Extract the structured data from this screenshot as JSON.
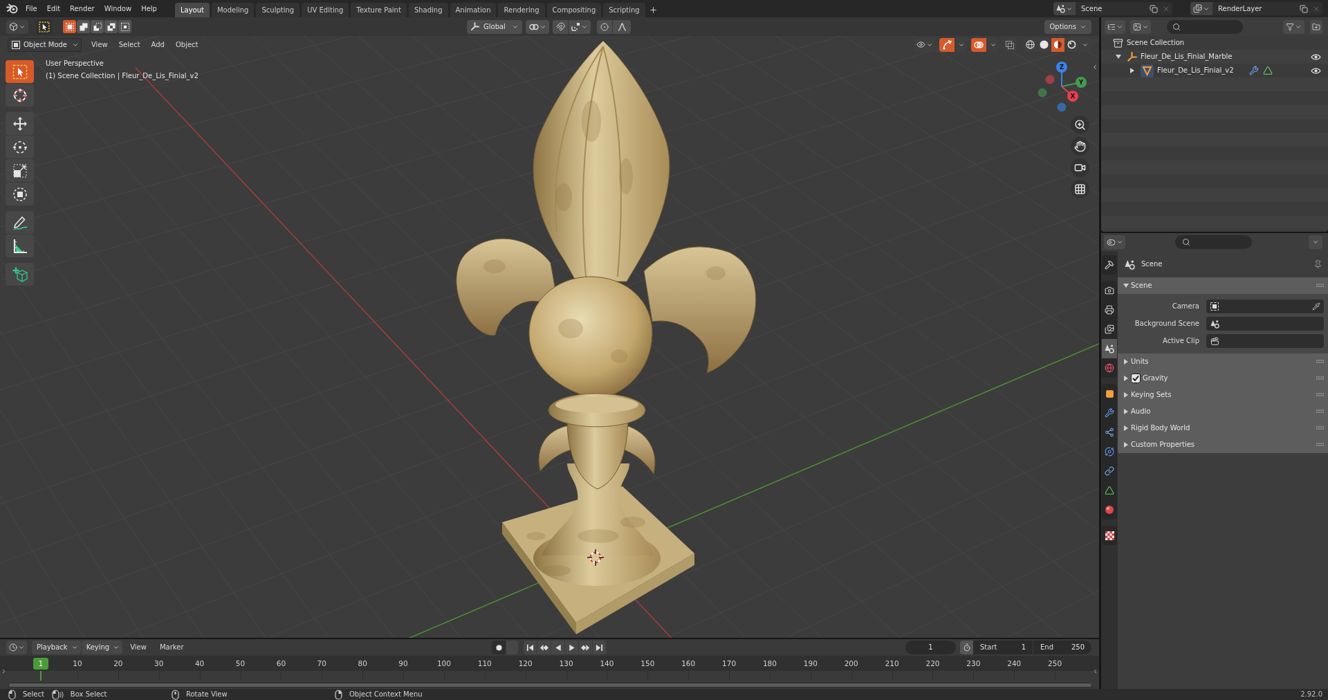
{
  "top_bar": {
    "menus": [
      "File",
      "Edit",
      "Render",
      "Window",
      "Help"
    ],
    "workspaces": [
      {
        "label": "Layout",
        "selected": true
      },
      {
        "label": "Modeling",
        "selected": false
      },
      {
        "label": "Sculpting",
        "selected": false
      },
      {
        "label": "UV Editing",
        "selected": false
      },
      {
        "label": "Texture Paint",
        "selected": false
      },
      {
        "label": "Shading",
        "selected": false
      },
      {
        "label": "Animation",
        "selected": false
      },
      {
        "label": "Rendering",
        "selected": false
      },
      {
        "label": "Compositing",
        "selected": false
      },
      {
        "label": "Scripting",
        "selected": false
      }
    ],
    "scene": "Scene",
    "view_layer": "RenderLayer"
  },
  "tool_header": {
    "selection_modes": [
      {
        "kind": "set",
        "selected": true
      },
      {
        "kind": "extend",
        "selected": false
      },
      {
        "kind": "subtract",
        "selected": false
      },
      {
        "kind": "difference",
        "selected": false
      },
      {
        "kind": "intersect",
        "selected": false
      }
    ],
    "transform_orientation": "Global",
    "snap": {
      "on": false
    },
    "proportional_editing": {
      "on": false
    },
    "options": "Options"
  },
  "viewport_header": {
    "mode": "Object Mode",
    "menus": [
      "View",
      "Select",
      "Add",
      "Object"
    ],
    "toggles": [
      {
        "kind": "gizmo",
        "on": true
      },
      {
        "kind": "overlay",
        "on": true
      },
      {
        "kind": "xray",
        "on": false
      }
    ],
    "shading_modes": [
      {
        "kind": "wireframe",
        "selected": false
      },
      {
        "kind": "solid",
        "selected": false
      },
      {
        "kind": "material",
        "selected": true
      },
      {
        "kind": "rendered",
        "selected": false
      }
    ]
  },
  "viewport": {
    "view_name": "User Perspective",
    "context": "(1) Scene Collection | Fleur_De_Lis_Finial_v2",
    "tool_groups": [
      {
        "tools": [
          {
            "kind": "select_box",
            "selected": true
          },
          {
            "kind": "cursor",
            "selected": false
          }
        ]
      },
      {
        "tools": [
          {
            "kind": "move",
            "selected": false
          },
          {
            "kind": "rotate",
            "selected": false
          },
          {
            "kind": "scale",
            "selected": false
          },
          {
            "kind": "transform",
            "selected": false
          }
        ]
      },
      {
        "tools": [
          {
            "kind": "annotate",
            "selected": false
          },
          {
            "kind": "measure",
            "selected": false
          }
        ]
      },
      {
        "tools": [
          {
            "kind": "add_cube",
            "selected": false
          }
        ]
      }
    ],
    "nav_axes": [
      {
        "label": "Z",
        "color": "#3b83e6"
      },
      {
        "label": "Y",
        "color": "#46994f"
      },
      {
        "label": "X",
        "color": "#e5404f"
      }
    ]
  },
  "outliner": {
    "tree": [
      {
        "name": "Scene Collection",
        "kind": "collection",
        "children": [
          {
            "name": "Fleur_De_Lis_Finial_Marble",
            "kind": "empty",
            "expanded": true,
            "visible": true,
            "children": [
              {
                "name": "Fleur_De_Lis_Finial_v2",
                "kind": "mesh",
                "expanded": false,
                "visible": true
              }
            ]
          }
        ]
      }
    ]
  },
  "properties": {
    "tab_groups": [
      {
        "tabs": [
          {
            "kind": "tool",
            "selected": false
          }
        ]
      },
      {
        "tabs": [
          {
            "kind": "render",
            "selected": false
          },
          {
            "kind": "output",
            "selected": false
          },
          {
            "kind": "view_layer",
            "selected": false
          },
          {
            "kind": "scene",
            "selected": true
          },
          {
            "kind": "world",
            "selected": false
          }
        ]
      },
      {
        "tabs": [
          {
            "kind": "object",
            "selected": false
          },
          {
            "kind": "modifiers",
            "selected": false
          },
          {
            "kind": "particles",
            "selected": false
          },
          {
            "kind": "physics",
            "selected": false
          },
          {
            "kind": "constraints",
            "selected": false
          },
          {
            "kind": "data",
            "selected": false
          },
          {
            "kind": "material",
            "selected": false
          }
        ]
      },
      {
        "tabs": [
          {
            "kind": "texture",
            "selected": false
          }
        ]
      }
    ],
    "context": "Scene",
    "panels": [
      {
        "title": "Scene",
        "expanded": true,
        "fields": [
          {
            "label": "Camera",
            "kind": "camera"
          },
          {
            "label": "Background Scene",
            "kind": "scene"
          },
          {
            "label": "Active Clip",
            "kind": "clip"
          }
        ]
      },
      {
        "title": "Units",
        "expanded": false
      },
      {
        "title": "Gravity",
        "expanded": false,
        "checked": true
      },
      {
        "title": "Keying Sets",
        "expanded": false
      },
      {
        "title": "Audio",
        "expanded": false
      },
      {
        "title": "Rigid Body World",
        "expanded": false
      },
      {
        "title": "Custom Properties",
        "expanded": false
      }
    ]
  },
  "timeline": {
    "menus": [
      {
        "label": "Playback",
        "kind": "dropdown"
      },
      {
        "label": "Keying",
        "kind": "dropdown"
      },
      {
        "label": "View",
        "kind": "menu"
      },
      {
        "label": "Marker",
        "kind": "menu"
      }
    ],
    "auto_keying": {
      "on": false
    },
    "current_frame": "1",
    "start_label": "Start",
    "start": "1",
    "end_label": "End",
    "end": "250",
    "playhead": "1",
    "ticks": [
      "10",
      "20",
      "30",
      "40",
      "50",
      "60",
      "70",
      "80",
      "90",
      "100",
      "110",
      "120",
      "130",
      "140",
      "150",
      "160",
      "170",
      "180",
      "190",
      "200",
      "210",
      "220",
      "230",
      "240",
      "250"
    ]
  },
  "status_bar": {
    "hint_groups": [
      {
        "hints": [
          {
            "kind": "left_click",
            "label": "Select"
          },
          {
            "kind": "left_drag",
            "label": "Box Select"
          }
        ]
      },
      {
        "hints": [
          {
            "kind": "middle_drag",
            "label": "Rotate View"
          }
        ]
      },
      {
        "hints": [
          {
            "kind": "right_click",
            "label": "Object Context Menu"
          }
        ]
      }
    ],
    "version": "2.92.0"
  }
}
